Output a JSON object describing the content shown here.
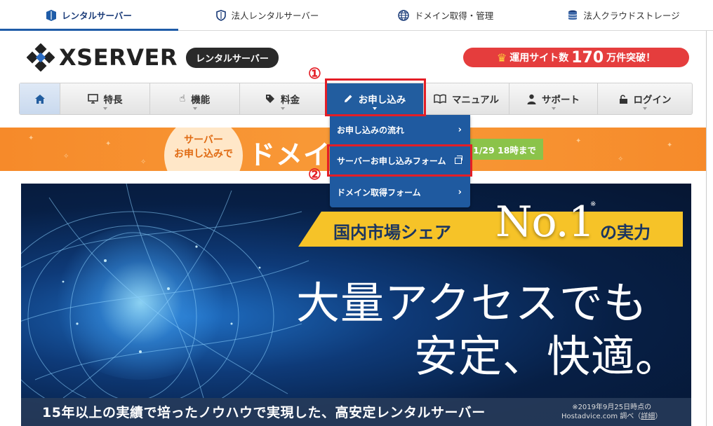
{
  "top_tabs": [
    {
      "label": "レンタルサーバー",
      "icon": "rental-server-icon",
      "active": true
    },
    {
      "label": "法人レンタルサーバー",
      "icon": "shield-icon",
      "active": false
    },
    {
      "label": "ドメイン取得・管理",
      "icon": "globe-icon",
      "active": false
    },
    {
      "label": "法人クラウドストレージ",
      "icon": "storage-icon",
      "active": false
    }
  ],
  "header": {
    "logo_text": "XSERVER",
    "logo_badge": "レンタルサーバー",
    "promo_prefix": "運用サイト数",
    "promo_number": "170",
    "promo_suffix": "万件突破！"
  },
  "nav": {
    "home_icon": "home-icon",
    "items": [
      {
        "label": "特長",
        "icon": "monitor-icon"
      },
      {
        "label": "機能",
        "icon": "pointer-icon"
      },
      {
        "label": "料金",
        "icon": "tag-icon"
      },
      {
        "label": "お申し込み",
        "icon": "pencil-icon"
      },
      {
        "label": "マニュアル",
        "icon": "book-icon"
      },
      {
        "label": "サポート",
        "icon": "person-icon"
      },
      {
        "label": "ログイン",
        "icon": "lock-icon"
      }
    ]
  },
  "dropdown": {
    "items": [
      {
        "label": "お申し込みの流れ"
      },
      {
        "label": "サーバーお申し込みフォーム"
      },
      {
        "label": "ドメイン取得フォーム"
      }
    ]
  },
  "campaign": {
    "circle_line1": "サーバー",
    "circle_line2": "お申し込みで",
    "title": "ドメイ",
    "date": "1/29 18時まで"
  },
  "hero": {
    "banner_left": "国内市場シェア",
    "no1": "No.1",
    "note_mark": "※",
    "banner_right": "の実力",
    "line1": "大量アクセスでも",
    "line2": "安定、快適。",
    "subline": "15年以上の実績で培ったノウハウで実現した、高安定レンタルサーバー",
    "source_line1": "※2019年9月25日時点の",
    "source_line2_prefix": "Hostadvice.com 調べ（",
    "source_link": "詳細",
    "source_line2_suffix": "）"
  },
  "annotations": [
    "①",
    "②"
  ],
  "colors": {
    "brand_blue": "#225d9f",
    "accent_red": "#e41e26",
    "campaign_orange": "#f68a2a",
    "promo_red": "#e53d3d"
  }
}
